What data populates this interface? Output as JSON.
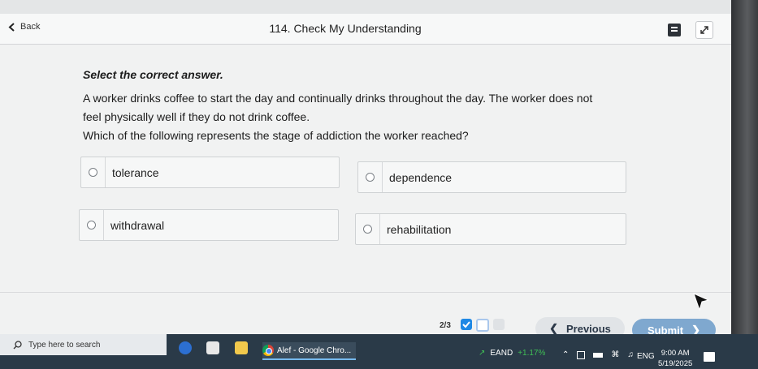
{
  "header": {
    "back_label": "Back",
    "title": "114. Check My Understanding"
  },
  "question": {
    "prompt": "Select the correct answer.",
    "lines": [
      "A worker drinks coffee to start the day and continually drinks throughout the day. The worker does not",
      "feel physically well if they do not drink coffee.",
      "Which of the following represents the stage of addiction the worker reached?"
    ]
  },
  "options": [
    {
      "label": "tolerance"
    },
    {
      "label": "dependence"
    },
    {
      "label": "withdrawal"
    },
    {
      "label": "rehabilitation"
    }
  ],
  "footer": {
    "page_indicator": "2/3",
    "previous_label": "Previous",
    "submit_label": "Submit"
  },
  "taskbar": {
    "search_placeholder": "Type here to search",
    "chrome_window": "Alef - Google Chro...",
    "stock_symbol": "EAND",
    "stock_change": "+1.17%",
    "language": "ENG",
    "time": "9:00 AM",
    "date": "5/19/2025"
  },
  "colors": {
    "submit": "#7fa8cf",
    "previous": "#e1e4e7",
    "dot_answered": "#1e88e5",
    "dot_current": "#a9c7ec",
    "taskbar": "#2a3a48"
  }
}
